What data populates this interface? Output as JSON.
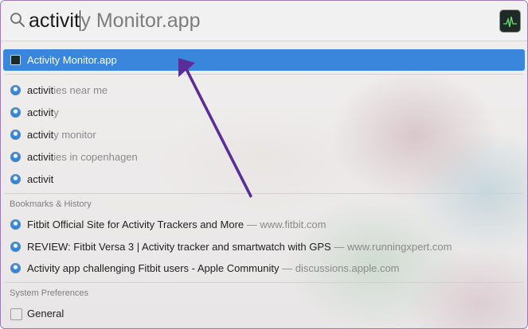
{
  "search": {
    "typed": "activit",
    "completion": "y Monitor.app"
  },
  "top_hit": {
    "label": "Activity Monitor.app",
    "icon": "activity-monitor-icon"
  },
  "suggestions": [
    {
      "typed": "activit",
      "rest": "ies near me"
    },
    {
      "typed": "activit",
      "rest": "y"
    },
    {
      "typed": "activit",
      "rest": "y monitor"
    },
    {
      "typed": "activit",
      "rest": "ies in copenhagen"
    },
    {
      "typed": "activit",
      "rest": ""
    }
  ],
  "bookmarks": {
    "header": "Bookmarks & History",
    "items": [
      {
        "title": "Fitbit Official Site for Activity Trackers and More",
        "source": "www.fitbit.com"
      },
      {
        "title": "REVIEW: Fitbit Versa 3 | Activity tracker and smartwatch with GPS",
        "source": "www.runningxpert.com"
      },
      {
        "title": "Activity app challenging Fitbit users - Apple Community",
        "source": "discussions.apple.com"
      }
    ],
    "separator": " — "
  },
  "system_prefs": {
    "header": "System Preferences",
    "items": [
      {
        "label": "General"
      }
    ]
  },
  "colors": {
    "selection": "#3a86dd",
    "annotation_arrow": "#5b2d99"
  }
}
